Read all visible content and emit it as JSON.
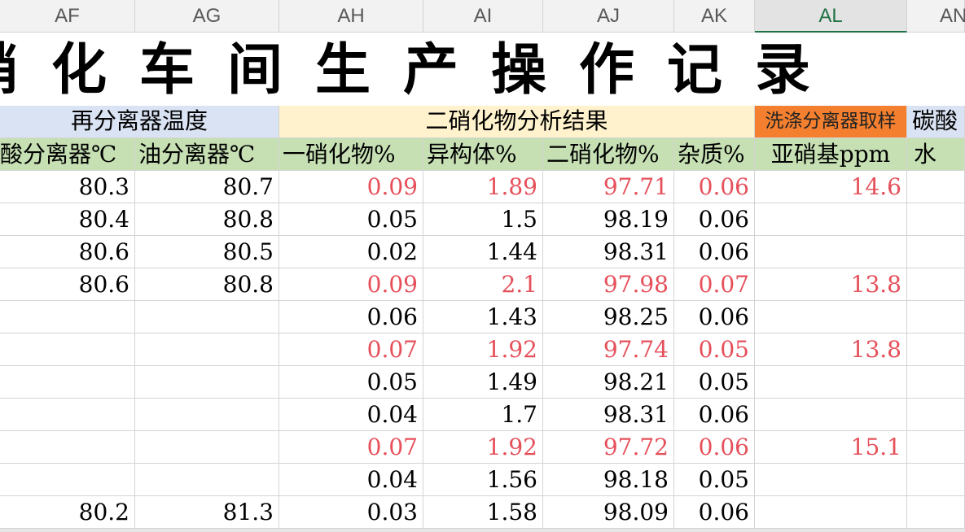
{
  "columns": [
    "AF",
    "AG",
    "AH",
    "AI",
    "AJ",
    "AK",
    "AL",
    "AN"
  ],
  "selected_column": "AL",
  "sheet_title": "硝化车间生产操作记录",
  "group_headers": {
    "reseparator_temp": "再分离器温度",
    "dinitro_analysis": "二硝化物分析结果",
    "wash_separator_sampling": "洗涤分离器取样",
    "carbonate_partial": "碳酸"
  },
  "sub_headers": {
    "acid_separator": "酸分离器℃",
    "oil_separator": "油分离器℃",
    "mononitro": "一硝化物%",
    "isomer": "异构体%",
    "dinitro": "二硝化物%",
    "impurity": "杂质%",
    "nitrite": "亚硝基ppm",
    "water": "水"
  },
  "rows": [
    {
      "af": "80.3",
      "ag": "80.7",
      "ah": "0.09",
      "ai": "1.89",
      "aj": "97.71",
      "ak": "0.06",
      "al": "14.6",
      "highlight": true
    },
    {
      "af": "80.4",
      "ag": "80.8",
      "ah": "0.05",
      "ai": "1.5",
      "aj": "98.19",
      "ak": "0.06",
      "al": "",
      "highlight": false
    },
    {
      "af": "80.6",
      "ag": "80.5",
      "ah": "0.02",
      "ai": "1.44",
      "aj": "98.31",
      "ak": "0.06",
      "al": "",
      "highlight": false
    },
    {
      "af": "80.6",
      "ag": "80.8",
      "ah": "0.09",
      "ai": "2.1",
      "aj": "97.98",
      "ak": "0.07",
      "al": "13.8",
      "highlight": true
    },
    {
      "af": "",
      "ag": "",
      "ah": "0.06",
      "ai": "1.43",
      "aj": "98.25",
      "ak": "0.06",
      "al": "",
      "highlight": false
    },
    {
      "af": "",
      "ag": "",
      "ah": "0.07",
      "ai": "1.92",
      "aj": "97.74",
      "ak": "0.05",
      "al": "13.8",
      "highlight": true
    },
    {
      "af": "",
      "ag": "",
      "ah": "0.05",
      "ai": "1.49",
      "aj": "98.21",
      "ak": "0.05",
      "al": "",
      "highlight": false
    },
    {
      "af": "",
      "ag": "",
      "ah": "0.04",
      "ai": "1.7",
      "aj": "98.31",
      "ak": "0.06",
      "al": "",
      "highlight": false
    },
    {
      "af": "",
      "ag": "",
      "ah": "0.07",
      "ai": "1.92",
      "aj": "97.72",
      "ak": "0.06",
      "al": "15.1",
      "highlight": true
    },
    {
      "af": "",
      "ag": "",
      "ah": "0.04",
      "ai": "1.56",
      "aj": "98.18",
      "ak": "0.05",
      "al": "",
      "highlight": false
    },
    {
      "af": "80.2",
      "ag": "81.3",
      "ah": "0.03",
      "ai": "1.58",
      "aj": "98.09",
      "ak": "0.06",
      "al": "",
      "highlight": false
    }
  ],
  "colors": {
    "highlight_text": "#e6505a",
    "blue_group": "#dae3f3",
    "yellow_group": "#fff2cc",
    "orange_group": "#f4802f",
    "green_subheader": "#c6e0b4",
    "selected_column_accent": "#217346"
  }
}
